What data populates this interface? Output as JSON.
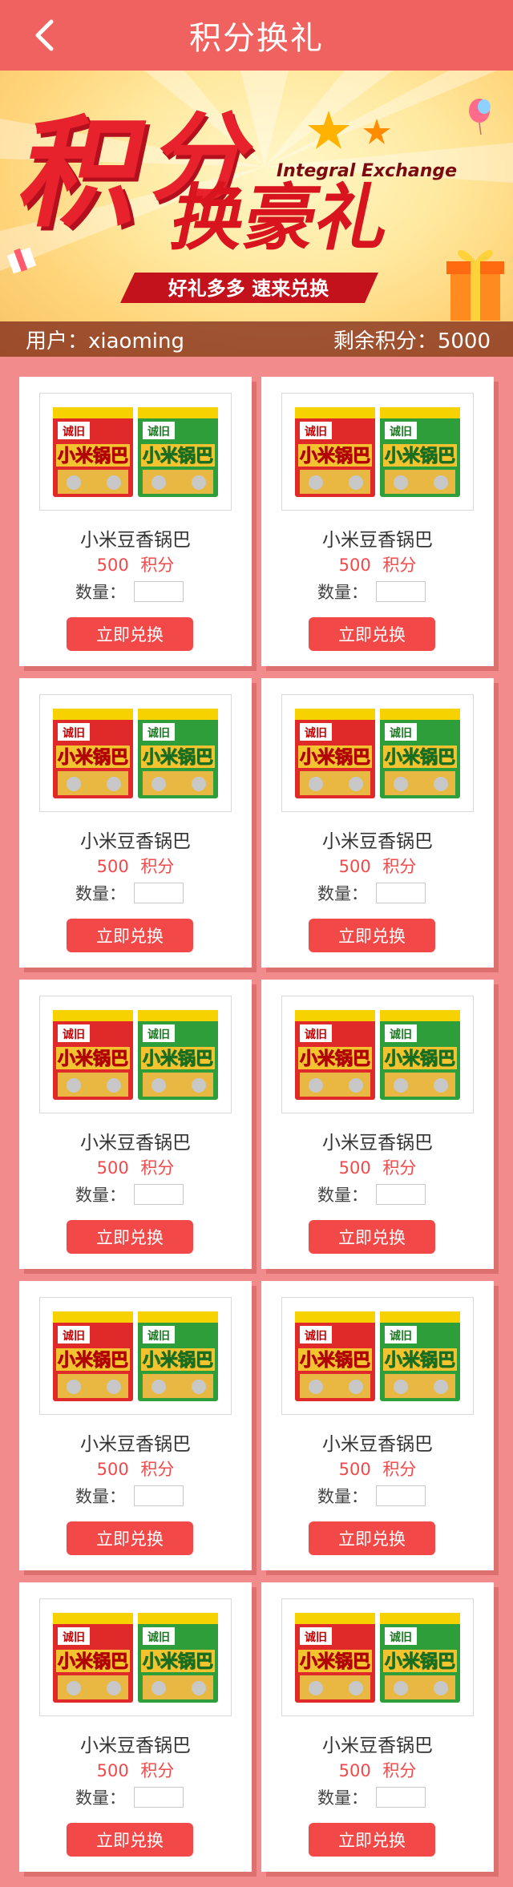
{
  "header": {
    "title": "积分换礼",
    "back_icon": "chevron-left-icon"
  },
  "banner": {
    "headline": "积分换豪礼",
    "english_text": "Integral Exchange",
    "slogan": "好礼多多  速来兑换"
  },
  "user_info": {
    "user_label": "用户：xiaoming",
    "points_label": "剩余积分：5000"
  },
  "products": [
    {
      "name": "小米豆香锅巴",
      "points_value": "500",
      "points_unit": "积分",
      "qty_label": "数量：",
      "qty_value": "",
      "button_label": "立即兑换"
    },
    {
      "name": "小米豆香锅巴",
      "points_value": "500",
      "points_unit": "积分",
      "qty_label": "数量：",
      "qty_value": "",
      "button_label": "立即兑换"
    },
    {
      "name": "小米豆香锅巴",
      "points_value": "500",
      "points_unit": "积分",
      "qty_label": "数量：",
      "qty_value": "",
      "button_label": "立即兑换"
    },
    {
      "name": "小米豆香锅巴",
      "points_value": "500",
      "points_unit": "积分",
      "qty_label": "数量：",
      "qty_value": "",
      "button_label": "立即兑换"
    },
    {
      "name": "小米豆香锅巴",
      "points_value": "500",
      "points_unit": "积分",
      "qty_label": "数量：",
      "qty_value": "",
      "button_label": "立即兑换"
    },
    {
      "name": "小米豆香锅巴",
      "points_value": "500",
      "points_unit": "积分",
      "qty_label": "数量：",
      "qty_value": "",
      "button_label": "立即兑换"
    },
    {
      "name": "小米豆香锅巴",
      "points_value": "500",
      "points_unit": "积分",
      "qty_label": "数量：",
      "qty_value": "",
      "button_label": "立即兑换"
    },
    {
      "name": "小米豆香锅巴",
      "points_value": "500",
      "points_unit": "积分",
      "qty_label": "数量：",
      "qty_value": "",
      "button_label": "立即兑换"
    },
    {
      "name": "小米豆香锅巴",
      "points_value": "500",
      "points_unit": "积分",
      "qty_label": "数量：",
      "qty_value": "",
      "button_label": "立即兑换"
    },
    {
      "name": "小米豆香锅巴",
      "points_value": "500",
      "points_unit": "积分",
      "qty_label": "数量：",
      "qty_value": "",
      "button_label": "立即兑换"
    }
  ],
  "colors": {
    "header_bg": "#f0625f",
    "page_bg": "#f28c8c",
    "accent_red": "#f24848",
    "points_text": "#f14a4a"
  }
}
